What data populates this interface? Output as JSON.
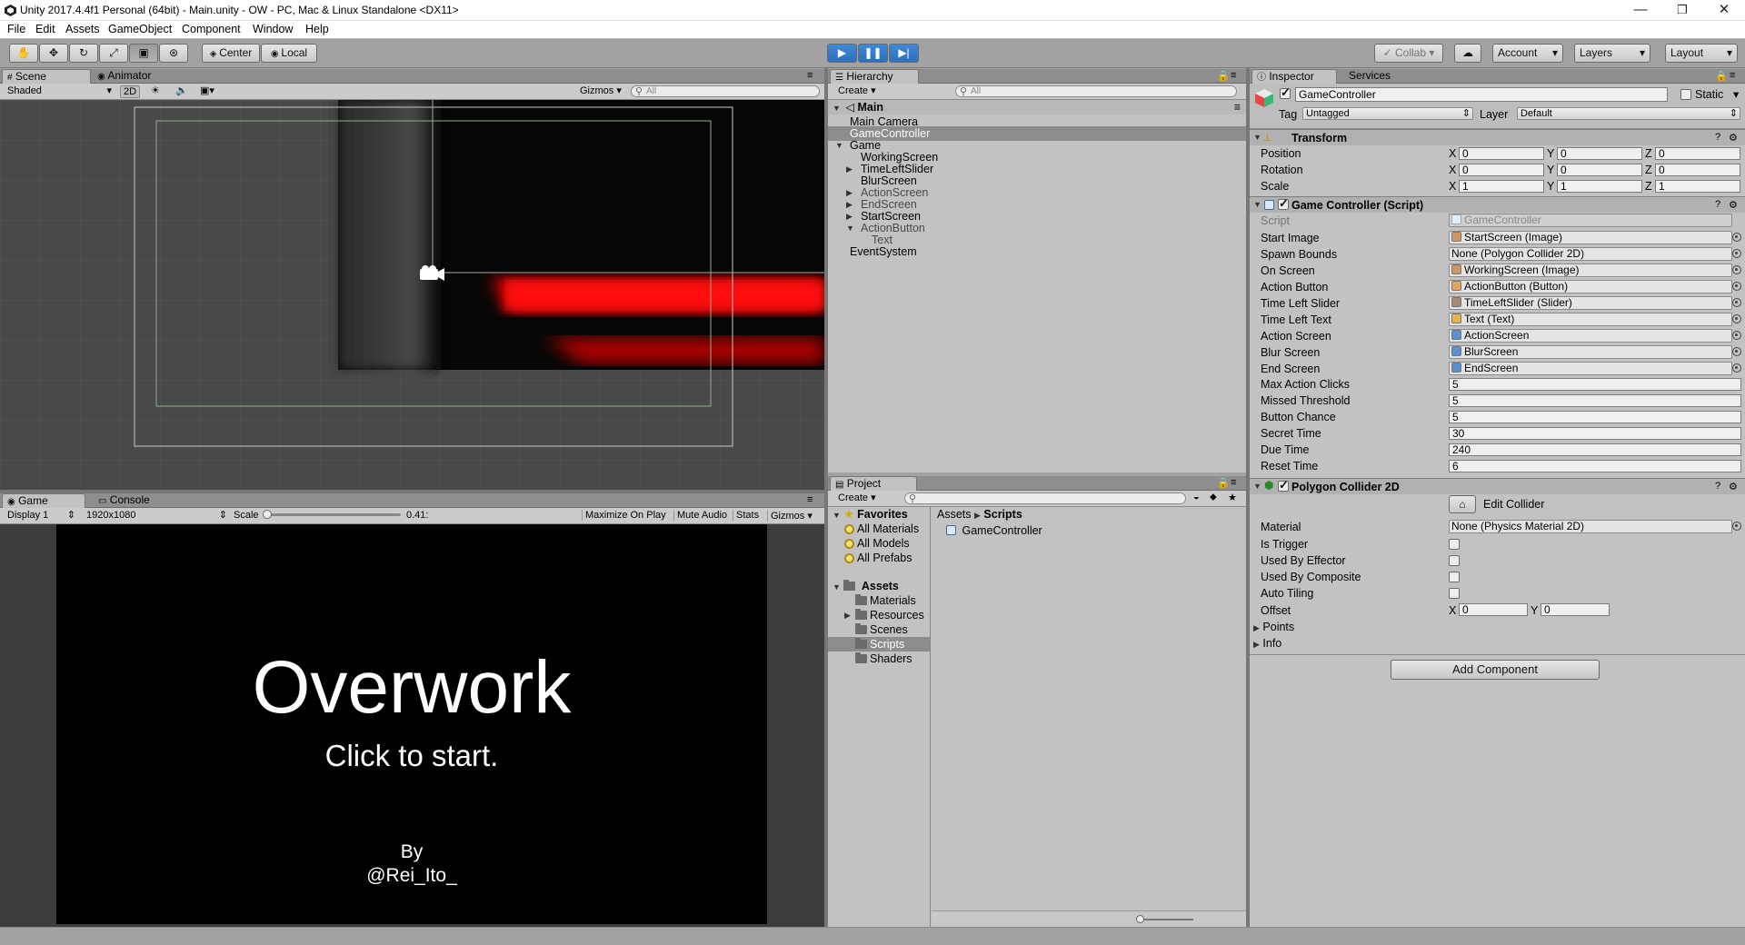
{
  "window": {
    "title": "Unity 2017.4.4f1 Personal (64bit) - Main.unity - OW - PC, Mac & Linux Standalone <DX11>",
    "controls": [
      "—",
      "❐",
      "✕"
    ]
  },
  "menu": [
    "File",
    "Edit",
    "Assets",
    "GameObject",
    "Component",
    "Window",
    "Help"
  ],
  "toolbar": {
    "pivot_center": "Center",
    "pivot_local": "Local",
    "collab": "Collab",
    "account": "Account",
    "layers": "Layers",
    "layout": "Layout"
  },
  "scene": {
    "tabs": [
      "Scene",
      "Animator"
    ],
    "shading": "Shaded",
    "mode_2d": "2D",
    "gizmos": "Gizmos",
    "search_placeholder": "All"
  },
  "game": {
    "tabs": [
      "Game",
      "Console"
    ],
    "display": "Display 1",
    "resolution": "1920x1080",
    "scale_label": "Scale",
    "scale_value": "0.41:",
    "scale_fraction": 0.02,
    "buttons": [
      "Maximize On Play",
      "Mute Audio",
      "Stats",
      "Gizmos"
    ],
    "title": "Overwork",
    "subtitle": "Click to start.",
    "by_line": "By",
    "author": "@Rei_Ito_"
  },
  "hierarchy": {
    "tab": "Hierarchy",
    "create": "Create",
    "search_placeholder": "All",
    "scene_name": "Main",
    "items": [
      {
        "label": "Main Camera",
        "arrow": "",
        "active": true,
        "selected": false
      },
      {
        "label": "GameController",
        "arrow": "",
        "active": true,
        "selected": true
      },
      {
        "label": "Game",
        "arrow": "▼",
        "active": true,
        "selected": false
      },
      {
        "label": "WorkingScreen",
        "arrow": "",
        "active": true,
        "selected": false
      },
      {
        "label": "TimeLeftSlider",
        "arrow": "▶",
        "active": true,
        "selected": false
      },
      {
        "label": "BlurScreen",
        "arrow": "",
        "active": true,
        "selected": false
      },
      {
        "label": "ActionScreen",
        "arrow": "▶",
        "active": false,
        "selected": false
      },
      {
        "label": "EndScreen",
        "arrow": "▶",
        "active": false,
        "selected": false
      },
      {
        "label": "StartScreen",
        "arrow": "▶",
        "active": true,
        "selected": false
      },
      {
        "label": "ActionButton",
        "arrow": "▼",
        "active": false,
        "selected": false
      },
      {
        "label": "Text",
        "arrow": "",
        "active": false,
        "selected": false
      },
      {
        "label": "EventSystem",
        "arrow": "",
        "active": true,
        "selected": false
      }
    ]
  },
  "project": {
    "tab": "Project",
    "create": "Create",
    "favorites_label": "Favorites",
    "favorites": [
      "All Materials",
      "All Models",
      "All Prefabs"
    ],
    "assets_label": "Assets",
    "folders": [
      "Materials",
      "Resources",
      "Scenes",
      "Scripts",
      "Shaders"
    ],
    "breadcrumb_root": "Assets",
    "breadcrumb_sep": "▶",
    "breadcrumb_current": "Scripts",
    "files": [
      "GameController"
    ]
  },
  "inspector": {
    "tabs": [
      "Inspector",
      "Services"
    ],
    "object_name": "GameController",
    "static_label": "Static",
    "tag_label": "Tag",
    "tag_value": "Untagged",
    "layer_label": "Layer",
    "layer_value": "Default",
    "transform": {
      "title": "Transform",
      "rows": [
        {
          "label": "Position",
          "x": "0",
          "y": "0",
          "z": "0"
        },
        {
          "label": "Rotation",
          "x": "0",
          "y": "0",
          "z": "0"
        },
        {
          "label": "Scale",
          "x": "1",
          "y": "1",
          "z": "1"
        }
      ]
    },
    "script_component": {
      "title": "Game Controller (Script)",
      "script_label": "Script",
      "script_value": "GameController",
      "refs": [
        {
          "label": "Start Image",
          "value": "StartScreen (Image)",
          "icon": "image-icon"
        },
        {
          "label": "Spawn Bounds",
          "value": "None (Polygon Collider 2D)",
          "icon": ""
        },
        {
          "label": "On Screen",
          "value": "WorkingScreen (Image)",
          "icon": "image-icon"
        },
        {
          "label": "Action Button",
          "value": "ActionButton (Button)",
          "icon": "button-icon"
        },
        {
          "label": "Time Left Slider",
          "value": "TimeLeftSlider (Slider)",
          "icon": "slider-icon"
        },
        {
          "label": "Time Left Text",
          "value": "Text (Text)",
          "icon": "text-icon"
        },
        {
          "label": "Action Screen",
          "value": "ActionScreen",
          "icon": "gameobject-icon"
        },
        {
          "label": "Blur Screen",
          "value": "BlurScreen",
          "icon": "gameobject-icon"
        },
        {
          "label": "End Screen",
          "value": "EndScreen",
          "icon": "gameobject-icon"
        }
      ],
      "values": [
        {
          "label": "Max Action Clicks",
          "value": "5"
        },
        {
          "label": "Missed Threshold",
          "value": "5"
        },
        {
          "label": "Button Chance",
          "value": "5"
        },
        {
          "label": "Secret Time",
          "value": "30"
        },
        {
          "label": "Due Time",
          "value": "240"
        },
        {
          "label": "Reset Time",
          "value": "6"
        }
      ]
    },
    "collider": {
      "title": "Polygon Collider 2D",
      "edit_label": "Edit Collider",
      "material_label": "Material",
      "material_value": "None (Physics Material 2D)",
      "checks": [
        "Is Trigger",
        "Used By Effector",
        "Used By Composite",
        "Auto Tiling"
      ],
      "offset_label": "Offset",
      "offset_x": "0",
      "offset_y": "0",
      "points_label": "Points",
      "info_label": "Info"
    },
    "add_component": "Add Component"
  },
  "colors": {
    "panel": "#a2a2a2",
    "selection": "#8d8d8d",
    "play_blue": "#2f78cc",
    "scene_red": "#d20000"
  }
}
